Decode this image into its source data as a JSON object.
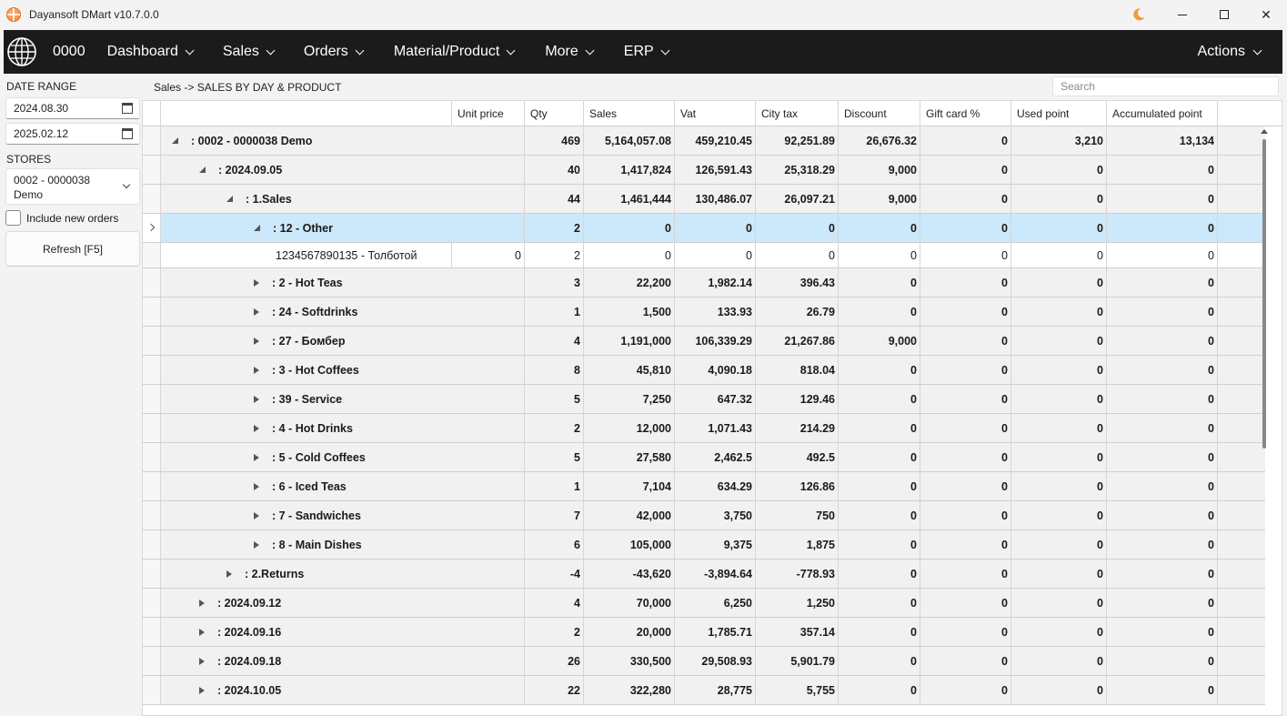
{
  "window": {
    "title": "Dayansoft DMart v10.7.0.0"
  },
  "nav": {
    "code": "0000",
    "items": [
      "Dashboard",
      "Sales",
      "Orders",
      "Material/Product",
      "More",
      "ERP"
    ],
    "actions": "Actions"
  },
  "sidebar": {
    "date_range_label": "DATE RANGE",
    "date_from": "2024.08.30",
    "date_to": "2025.02.12",
    "stores_label": "STORES",
    "store_line1": "0002 - 0000038",
    "store_line2": "Demo",
    "include_new_orders": "Include new orders",
    "refresh": "Refresh [F5]"
  },
  "breadcrumb": "Sales -> SALES BY DAY & PRODUCT",
  "search": {
    "placeholder": "Search"
  },
  "grid": {
    "columns": [
      "Unit price",
      "Qty",
      "Sales",
      "Vat",
      "City tax",
      "Discount",
      "Gift card %",
      "Used point",
      "Accumulated point"
    ],
    "rows": [
      {
        "level": 0,
        "state": "open",
        "label": ": 0002 - 0000038 Demo",
        "unit": "",
        "qty": "469",
        "sales": "5,164,057.08",
        "vat": "459,210.45",
        "city": "92,251.89",
        "disc": "26,676.32",
        "gift": "0",
        "used": "3,210",
        "acc": "13,134"
      },
      {
        "level": 1,
        "state": "open",
        "label": ": 2024.09.05",
        "unit": "",
        "qty": "40",
        "sales": "1,417,824",
        "vat": "126,591.43",
        "city": "25,318.29",
        "disc": "9,000",
        "gift": "0",
        "used": "0",
        "acc": "0"
      },
      {
        "level": 2,
        "state": "open",
        "label": ": 1.Sales",
        "unit": "",
        "qty": "44",
        "sales": "1,461,444",
        "vat": "130,486.07",
        "city": "26,097.21",
        "disc": "9,000",
        "gift": "0",
        "used": "0",
        "acc": "0"
      },
      {
        "level": 3,
        "state": "open",
        "label": ": 12 - Other",
        "unit": "",
        "qty": "2",
        "sales": "0",
        "vat": "0",
        "city": "0",
        "disc": "0",
        "gift": "0",
        "used": "0",
        "acc": "0",
        "selected": true
      },
      {
        "level": 4,
        "state": "leaf",
        "label": "1234567890135 - Толботой",
        "unit": "0",
        "qty": "2",
        "sales": "0",
        "vat": "0",
        "city": "0",
        "disc": "0",
        "gift": "0",
        "used": "0",
        "acc": "0"
      },
      {
        "level": 3,
        "state": "closed",
        "label": ": 2 - Hot Teas",
        "unit": "",
        "qty": "3",
        "sales": "22,200",
        "vat": "1,982.14",
        "city": "396.43",
        "disc": "0",
        "gift": "0",
        "used": "0",
        "acc": "0"
      },
      {
        "level": 3,
        "state": "closed",
        "label": ": 24 - Softdrinks",
        "unit": "",
        "qty": "1",
        "sales": "1,500",
        "vat": "133.93",
        "city": "26.79",
        "disc": "0",
        "gift": "0",
        "used": "0",
        "acc": "0"
      },
      {
        "level": 3,
        "state": "closed",
        "label": ": 27 - Бомбер",
        "unit": "",
        "qty": "4",
        "sales": "1,191,000",
        "vat": "106,339.29",
        "city": "21,267.86",
        "disc": "9,000",
        "gift": "0",
        "used": "0",
        "acc": "0"
      },
      {
        "level": 3,
        "state": "closed",
        "label": ": 3 - Hot Coffees",
        "unit": "",
        "qty": "8",
        "sales": "45,810",
        "vat": "4,090.18",
        "city": "818.04",
        "disc": "0",
        "gift": "0",
        "used": "0",
        "acc": "0"
      },
      {
        "level": 3,
        "state": "closed",
        "label": ": 39 - Service",
        "unit": "",
        "qty": "5",
        "sales": "7,250",
        "vat": "647.32",
        "city": "129.46",
        "disc": "0",
        "gift": "0",
        "used": "0",
        "acc": "0"
      },
      {
        "level": 3,
        "state": "closed",
        "label": ": 4 - Hot Drinks",
        "unit": "",
        "qty": "2",
        "sales": "12,000",
        "vat": "1,071.43",
        "city": "214.29",
        "disc": "0",
        "gift": "0",
        "used": "0",
        "acc": "0"
      },
      {
        "level": 3,
        "state": "closed",
        "label": ": 5 - Cold Coffees",
        "unit": "",
        "qty": "5",
        "sales": "27,580",
        "vat": "2,462.5",
        "city": "492.5",
        "disc": "0",
        "gift": "0",
        "used": "0",
        "acc": "0"
      },
      {
        "level": 3,
        "state": "closed",
        "label": ": 6 - Iced Teas",
        "unit": "",
        "qty": "1",
        "sales": "7,104",
        "vat": "634.29",
        "city": "126.86",
        "disc": "0",
        "gift": "0",
        "used": "0",
        "acc": "0"
      },
      {
        "level": 3,
        "state": "closed",
        "label": ": 7 - Sandwiches",
        "unit": "",
        "qty": "7",
        "sales": "42,000",
        "vat": "3,750",
        "city": "750",
        "disc": "0",
        "gift": "0",
        "used": "0",
        "acc": "0"
      },
      {
        "level": 3,
        "state": "closed",
        "label": ": 8 - Main Dishes",
        "unit": "",
        "qty": "6",
        "sales": "105,000",
        "vat": "9,375",
        "city": "1,875",
        "disc": "0",
        "gift": "0",
        "used": "0",
        "acc": "0"
      },
      {
        "level": 2,
        "state": "closed",
        "label": ": 2.Returns",
        "unit": "",
        "qty": "-4",
        "sales": "-43,620",
        "vat": "-3,894.64",
        "city": "-778.93",
        "disc": "0",
        "gift": "0",
        "used": "0",
        "acc": "0"
      },
      {
        "level": 1,
        "state": "closed",
        "label": ": 2024.09.12",
        "unit": "",
        "qty": "4",
        "sales": "70,000",
        "vat": "6,250",
        "city": "1,250",
        "disc": "0",
        "gift": "0",
        "used": "0",
        "acc": "0"
      },
      {
        "level": 1,
        "state": "closed",
        "label": ": 2024.09.16",
        "unit": "",
        "qty": "2",
        "sales": "20,000",
        "vat": "1,785.71",
        "city": "357.14",
        "disc": "0",
        "gift": "0",
        "used": "0",
        "acc": "0"
      },
      {
        "level": 1,
        "state": "closed",
        "label": ": 2024.09.18",
        "unit": "",
        "qty": "26",
        "sales": "330,500",
        "vat": "29,508.93",
        "city": "5,901.79",
        "disc": "0",
        "gift": "0",
        "used": "0",
        "acc": "0"
      },
      {
        "level": 1,
        "state": "closed",
        "label": ": 2024.10.05",
        "unit": "",
        "qty": "22",
        "sales": "322,280",
        "vat": "28,775",
        "city": "5,755",
        "disc": "0",
        "gift": "0",
        "used": "0",
        "acc": "0"
      }
    ]
  }
}
